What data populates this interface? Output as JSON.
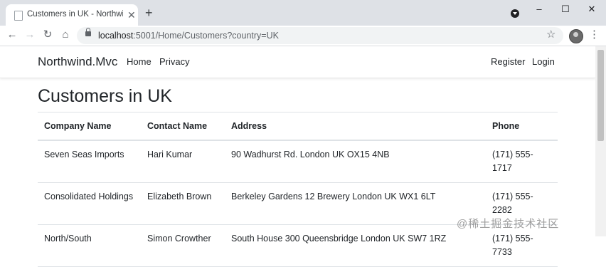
{
  "browser": {
    "tab_title": "Customers in UK - Northwind.Mvc",
    "new_tab_symbol": "+",
    "tab_close_symbol": "✕",
    "url_host": "localhost",
    "url_path": ":5001/Home/Customers?country=UK",
    "icons": [
      "favicon-icon",
      "back-icon",
      "forward-icon",
      "reload-icon",
      "home-icon",
      "lock-icon",
      "star-icon",
      "profile-avatar",
      "more-icon",
      "minimize-icon",
      "maximize-icon",
      "close-icon",
      "extension-icon"
    ]
  },
  "navbar": {
    "brand": "Northwind.Mvc",
    "links": [
      "Home",
      "Privacy"
    ],
    "right_links": [
      "Register",
      "Login"
    ]
  },
  "main": {
    "heading": "Customers in UK",
    "table": {
      "headers": [
        "Company Name",
        "Contact Name",
        "Address",
        "Phone"
      ],
      "rows": [
        {
          "company": "Seven Seas Imports",
          "contact": "Hari Kumar",
          "address": "90 Wadhurst Rd. London UK OX15 4NB",
          "phone": "(171) 555-1717"
        },
        {
          "company": "Consolidated Holdings",
          "contact": "Elizabeth Brown",
          "address": "Berkeley Gardens 12 Brewery London UK WX1 6LT",
          "phone": "(171) 555-2282"
        },
        {
          "company": "North/South",
          "contact": "Simon Crowther",
          "address": "South House 300 Queensbridge London UK SW7 1RZ",
          "phone": "(171) 555-7733"
        }
      ]
    }
  },
  "watermark": "@稀土掘金技术社区"
}
